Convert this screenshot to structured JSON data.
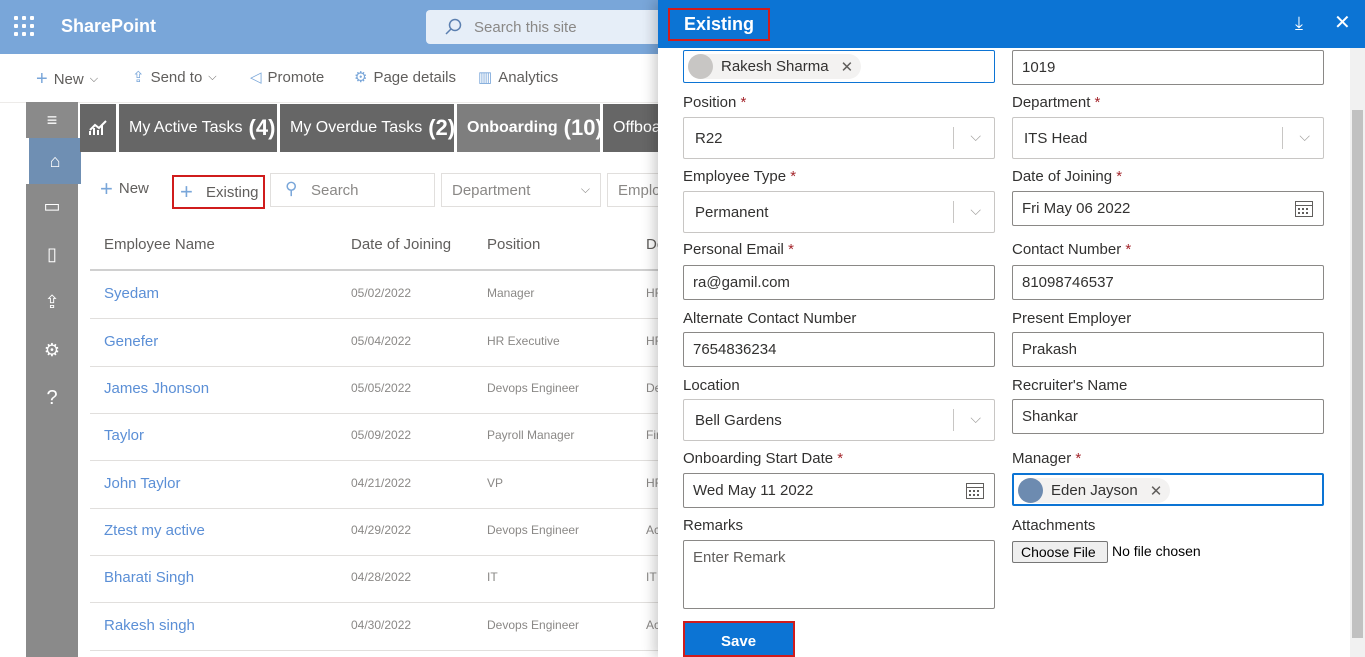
{
  "app": {
    "brand": "SharePoint",
    "search_placeholder": "Search this site"
  },
  "command_bar": {
    "new_label": "New",
    "send_to_label": "Send to",
    "promote_label": "Promote",
    "page_details_label": "Page details",
    "analytics_label": "Analytics"
  },
  "tabs": [
    {
      "label": "My Active Tasks",
      "count": "(4)"
    },
    {
      "label": "My Overdue Tasks",
      "count": "(2)"
    },
    {
      "label": "Onboarding",
      "count": "(10)"
    },
    {
      "label": "Offboa",
      "count": ""
    }
  ],
  "toolbar": {
    "new_label": "New",
    "existing_label": "Existing",
    "search_placeholder": "Search",
    "department_placeholder": "Department",
    "employee_placeholder": "Emplo"
  },
  "table": {
    "headers": [
      "Employee Name",
      "Date of Joining",
      "Position",
      "De"
    ],
    "rows": [
      {
        "name": "Syedam",
        "date": "05/02/2022",
        "position": "Manager",
        "dept": "HR"
      },
      {
        "name": "Genefer",
        "date": "05/04/2022",
        "position": "HR Executive",
        "dept": "HR"
      },
      {
        "name": "James Jhonson",
        "date": "05/05/2022",
        "position": "Devops Engineer",
        "dept": "De"
      },
      {
        "name": "Taylor",
        "date": "05/09/2022",
        "position": "Payroll Manager",
        "dept": "Fir"
      },
      {
        "name": "John Taylor",
        "date": "04/21/2022",
        "position": "VP",
        "dept": "HR"
      },
      {
        "name": "Ztest my active",
        "date": "04/29/2022",
        "position": "Devops Engineer",
        "dept": "Ac"
      },
      {
        "name": "Bharati Singh",
        "date": "04/28/2022",
        "position": "IT",
        "dept": "IT"
      },
      {
        "name": "Rakesh singh",
        "date": "04/30/2022",
        "position": "Devops Engineer",
        "dept": "Ac"
      }
    ]
  },
  "panel": {
    "title": "Existing",
    "employee_person": "Rakesh Sharma",
    "employee_id": "1019",
    "position_label": "Position",
    "position_value": "R22",
    "department_label": "Department",
    "department_value": "ITS Head",
    "employee_type_label": "Employee Type",
    "employee_type_value": "Permanent",
    "date_of_joining_label": "Date of Joining",
    "date_of_joining_value": "Fri May 06 2022",
    "personal_email_label": "Personal Email",
    "personal_email_value": "ra@gamil.com",
    "contact_number_label": "Contact Number",
    "contact_number_value": "81098746537",
    "alt_contact_label": "Alternate Contact Number",
    "alt_contact_value": "7654836234",
    "present_employer_label": "Present Employer",
    "present_employer_value": "Prakash",
    "location_label": "Location",
    "location_value": "Bell Gardens",
    "recruiter_label": "Recruiter's Name",
    "recruiter_value": "Shankar",
    "onboarding_start_label": "Onboarding Start Date",
    "onboarding_start_value": "Wed May 11 2022",
    "manager_label": "Manager",
    "manager_value": "Eden Jayson",
    "remarks_label": "Remarks",
    "remarks_placeholder": "Enter Remark",
    "attachments_label": "Attachments",
    "choose_file_label": "Choose File",
    "no_file_label": "No file chosen",
    "save_label": "Save",
    "required_mark": "*"
  },
  "colors": {
    "suite_bar": "#79a6d9",
    "panel_header": "#0c74d4",
    "highlight_red": "#d01c1c",
    "link_blue": "#5b8fd6"
  }
}
